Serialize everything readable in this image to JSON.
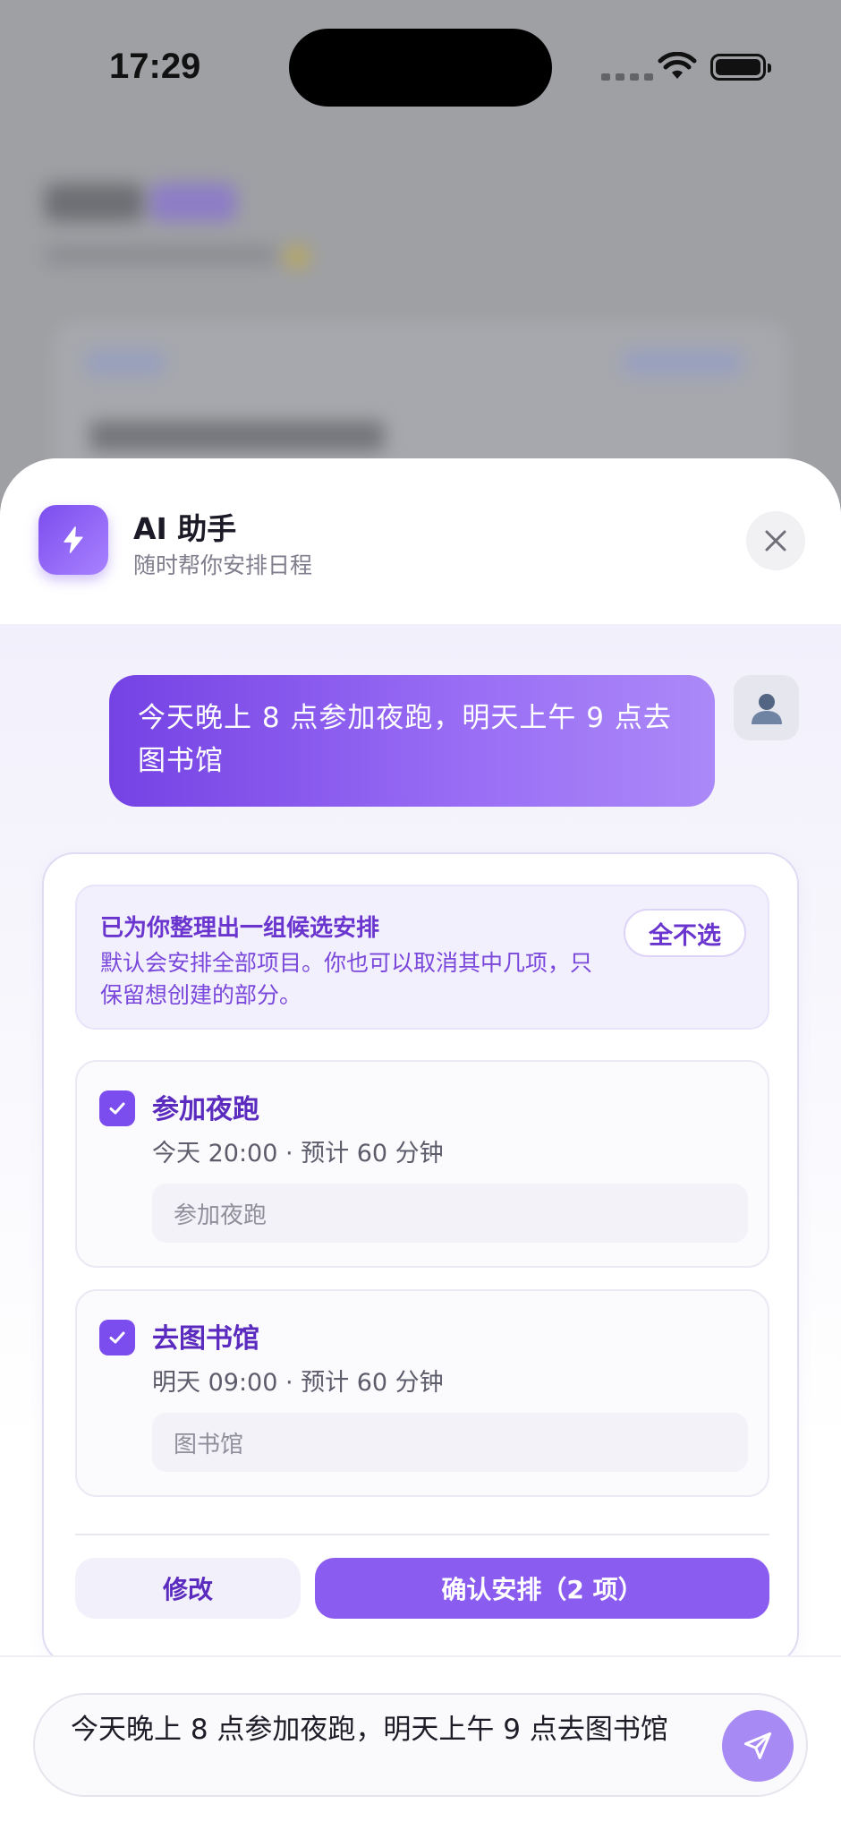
{
  "status_bar": {
    "time": "17:29"
  },
  "header": {
    "title": "AI 助手",
    "subtitle": "随时帮你安排日程"
  },
  "chat": {
    "user_message": "今天晚上 8 点参加夜跑，明天上午 9 点去图书馆"
  },
  "assistant": {
    "notice_title": "已为你整理出一组候选安排",
    "notice_desc": "默认会安排全部项目。你也可以取消其中几项，只保留想创建的部分。",
    "deselect_label": "全不选",
    "items": [
      {
        "title": "参加夜跑",
        "meta": "今天 20:00 · 预计 60 分钟",
        "input_value": "参加夜跑",
        "checked": true
      },
      {
        "title": "去图书馆",
        "meta": "明天 09:00 · 预计 60 分钟",
        "input_value": "图书馆",
        "checked": true
      }
    ],
    "edit_label": "修改",
    "confirm_label": "确认安排（2 项）"
  },
  "composer": {
    "value": "今天晚上 8 点参加夜跑，明天上午 9 点去图书馆"
  },
  "colors": {
    "accent": "#7c4dee",
    "accent_light": "#a88af4",
    "confirm": "#8b5cf0"
  },
  "icons": {
    "app": "lightning-icon",
    "close": "close-icon",
    "avatar": "user-icon",
    "check": "check-icon",
    "send": "send-icon"
  }
}
